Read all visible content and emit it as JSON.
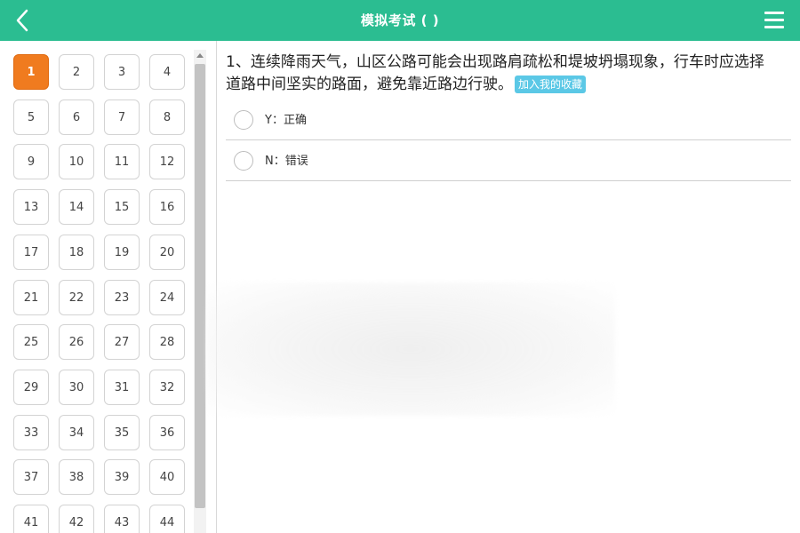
{
  "header": {
    "title": "模拟考试 ( )",
    "back_icon": "chevron-left-icon",
    "menu_icon": "hamburger-menu-icon",
    "bg_color": "#2bbd91"
  },
  "sidebar": {
    "active_index": 0,
    "active_color": "#f07b1f",
    "numbers": [
      "1",
      "2",
      "3",
      "4",
      "5",
      "6",
      "7",
      "8",
      "9",
      "10",
      "11",
      "12",
      "13",
      "14",
      "15",
      "16",
      "17",
      "18",
      "19",
      "20",
      "21",
      "22",
      "23",
      "24",
      "25",
      "26",
      "27",
      "28",
      "29",
      "30",
      "31",
      "32",
      "33",
      "34",
      "35",
      "36",
      "37",
      "38",
      "39",
      "40",
      "41",
      "42",
      "43",
      "44"
    ]
  },
  "question": {
    "text": "1、连续降雨天气，山区公路可能会出现路肩疏松和堤坡坍塌现象，行车时应选择道路中间坚实的路面，避免靠近路边行驶。",
    "favorite_label": "加入我的收藏",
    "favorite_color": "#5bc8e6"
  },
  "options": [
    {
      "label": "Y：正确"
    },
    {
      "label": "N：错误"
    }
  ]
}
